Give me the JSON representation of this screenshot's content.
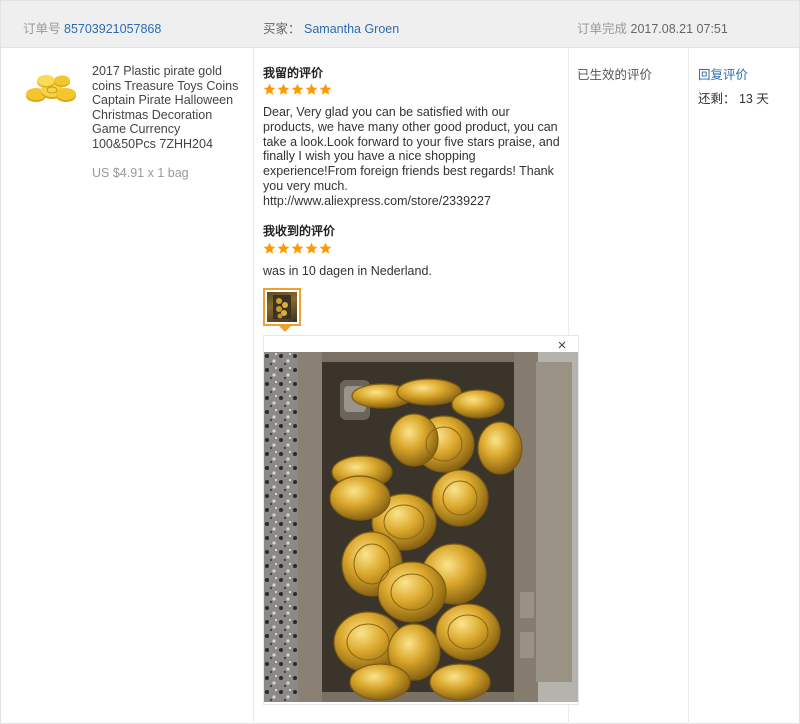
{
  "header": {
    "order_label": "订单号",
    "order_number": "85703921057868",
    "buyer_label": "买家：",
    "buyer_name": "Samantha Groen",
    "completed_label": "订单完成",
    "completed_time": "2017.08.21 07:51"
  },
  "product": {
    "title": "2017 Plastic pirate gold coins Treasure Toys Coins Captain Pirate Halloween Christmas Decoration Game Currency 100&50Pcs 7ZHH204",
    "price": "US $4.91 x 1 bag",
    "thumbnail_icon": "gold-coins-image"
  },
  "my_review": {
    "title": "我留的评价",
    "rating": 5,
    "text": "Dear, Very glad you can be satisfied with our products, we have many other good product, you can take a look.Look forward to your five stars praise, and finally I wish you have a nice shopping experience!From foreign friends best regards! Thank you very much.",
    "link": "http://www.aliexpress.com/store/2339227"
  },
  "received_review": {
    "title": "我收到的评价",
    "rating": 5,
    "text": "was in 10 dagen in Nederland."
  },
  "viewer": {
    "close_label": "×",
    "photo_icon": "treasure-chest-coins-photo"
  },
  "status": {
    "text": "已生效的评价"
  },
  "actions": {
    "reply_label": "回复评价",
    "remaining_text": "还剩： 13 天"
  },
  "colors": {
    "link": "#2c6bb1",
    "star": "#ff9900",
    "header_bg": "#efefef",
    "thumb_border": "#f0a030"
  }
}
